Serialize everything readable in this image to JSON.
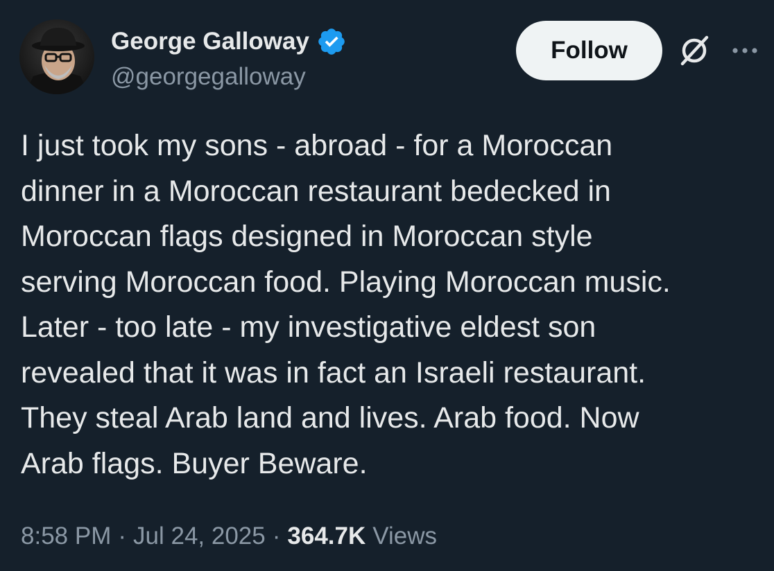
{
  "author": {
    "display_name": "George Galloway",
    "handle": "@georgegalloway",
    "verified_icon": "verified-badge-icon",
    "verified_color": "#1d9bf0"
  },
  "header": {
    "follow_label": "Follow",
    "grok_icon": "grok-icon",
    "more_icon": "more-options-icon"
  },
  "tweet": {
    "text": "I just took my sons - abroad - for a Moroccan\ndinner in a Moroccan restaurant bedecked in\nMoroccan flags designed in Moroccan style\nserving Moroccan food. Playing Moroccan music.\nLater - too late - my investigative eldest son\nrevealed that it was in fact an Israeli restaurant.\nThey steal Arab land and lives. Arab food. Now\nArab flags. Buyer Beware."
  },
  "meta": {
    "time": "8:58 PM",
    "separator": "·",
    "date": "Jul 24, 2025",
    "views_count": "364.7K",
    "views_label": "Views"
  },
  "colors": {
    "background": "#15202b",
    "primary_text": "#e7e9ea",
    "secondary_text": "#8b98a5",
    "follow_bg": "#eff3f4",
    "follow_text": "#0f1419"
  }
}
